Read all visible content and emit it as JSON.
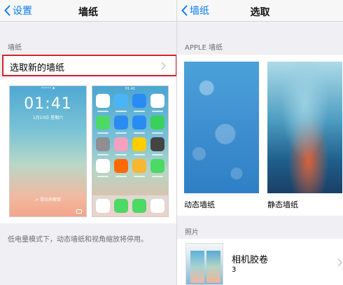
{
  "left_screen": {
    "nav": {
      "back_label": "设置",
      "title": "墙纸"
    },
    "section_header": "墙纸",
    "select_row_label": "选取新的墙纸",
    "lock_preview": {
      "status_bar": "•••••  ◈",
      "time": "01:41",
      "date": "1月10日 星期六",
      "slide_text": "> 滑动来解锁"
    },
    "home_preview": {
      "status_bar": "01:41",
      "app_colors": [
        "#ffffff",
        "#4cb4f5",
        "#2a8cf2",
        "#ffffff",
        "#4cd964",
        "#2a8cf2",
        "#2a8cf2",
        "#37d15c",
        "#8e8e93",
        "#f2a1c0",
        "#ffcc00",
        "#444444",
        "#ffffff",
        "#ff6a00",
        "#f7b733",
        "#4cd964"
      ],
      "dock_colors": [
        "#ffffff",
        "#4cd964",
        "#4cd964",
        "#ffffff"
      ]
    },
    "footer_text": "低电量模式下，动态墙纸和视角缩放将停用。"
  },
  "right_screen": {
    "nav": {
      "back_label": "墙纸",
      "title": "选取"
    },
    "section_header": "APPLE 墙纸",
    "wallpapers": [
      {
        "caption": "动态墙纸"
      },
      {
        "caption": "静态墙纸"
      }
    ],
    "photos_header": "照片",
    "album": {
      "title": "相机胶卷",
      "count": "3"
    }
  },
  "colors": {
    "accent": "#0a7cf5",
    "highlight_border": "#d6232a",
    "background": "#efeff4"
  }
}
